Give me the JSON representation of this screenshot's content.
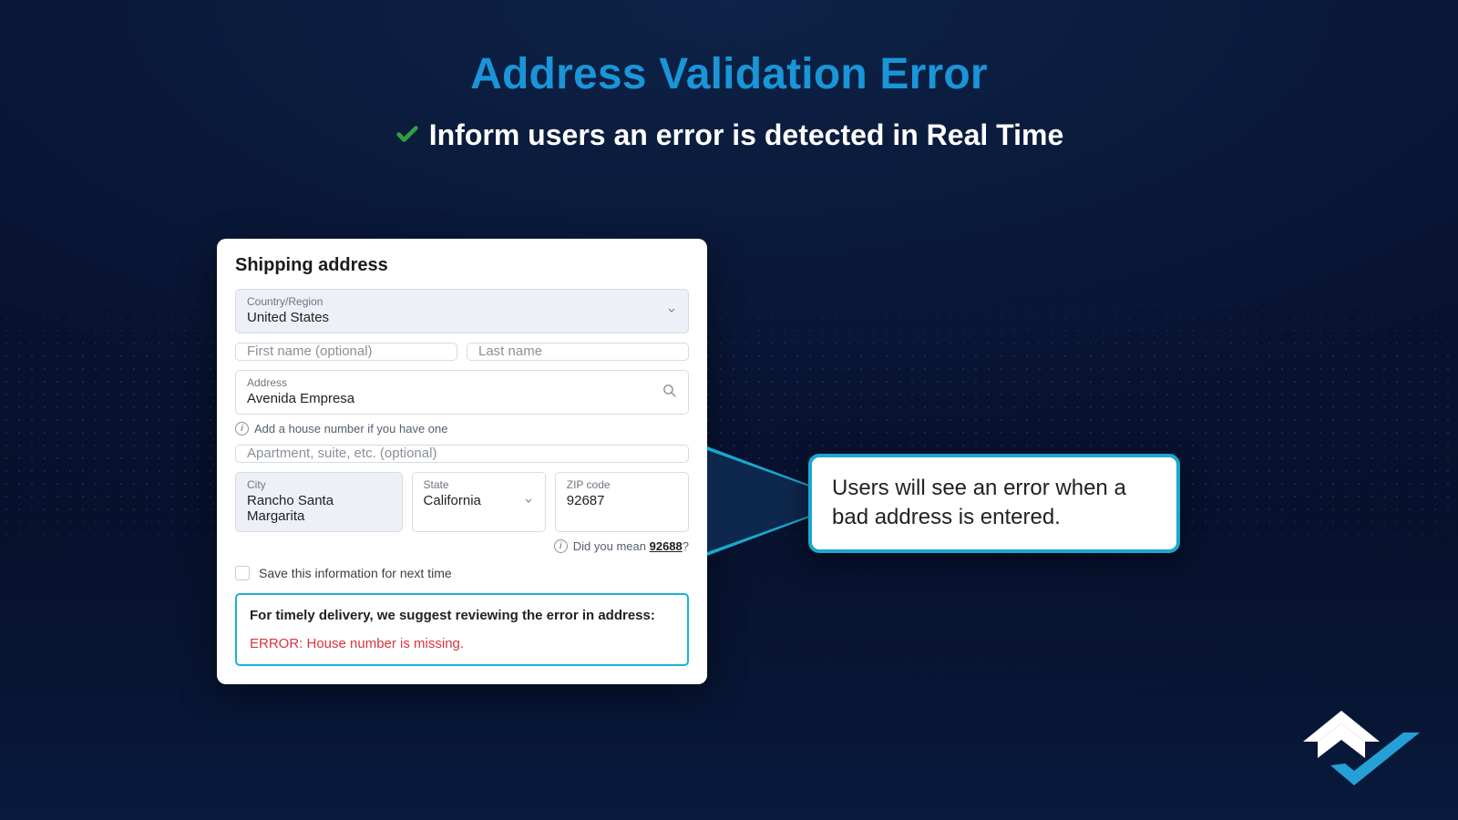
{
  "header": {
    "title": "Address Validation Error",
    "subtitle": "Inform users an error is detected in Real Time"
  },
  "form": {
    "heading": "Shipping address",
    "country": {
      "label": "Country/Region",
      "value": "United States"
    },
    "first_name": {
      "placeholder": "First name (optional)"
    },
    "last_name": {
      "placeholder": "Last name"
    },
    "address": {
      "label": "Address",
      "value": "Avenida Empresa"
    },
    "address_hint": "Add a house number if you have one",
    "apartment": {
      "placeholder": "Apartment, suite, etc. (optional)"
    },
    "city": {
      "label": "City",
      "value": "Rancho Santa Margarita"
    },
    "state": {
      "label": "State",
      "value": "California"
    },
    "zip": {
      "label": "ZIP code",
      "value": "92687"
    },
    "zip_hint_prefix": "Did you mean ",
    "zip_suggestion": "92688",
    "zip_hint_suffix": "?",
    "save_label": "Save this information for next time",
    "error_panel": {
      "title": "For timely delivery, we suggest reviewing the error in address:",
      "message": "ERROR: House number is missing."
    }
  },
  "callout": {
    "text": "Users will see an error when a bad address is entered."
  },
  "colors": {
    "accent": "#1995d8",
    "callout_border": "#1aa7d0",
    "error": "#d9333f",
    "check": "#2ea043"
  }
}
